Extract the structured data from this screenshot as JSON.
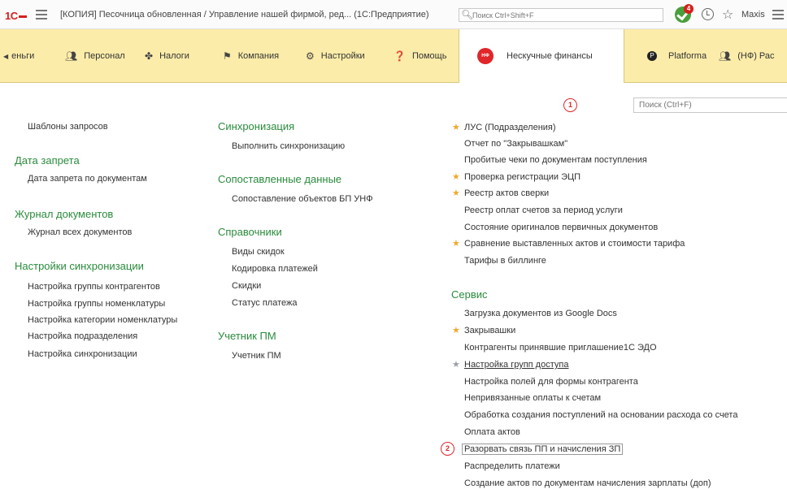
{
  "titlebar": {
    "logo": "1С",
    "title": "[КОПИЯ] Песочница обновленная / Управление нашей фирмой, ред...  (1С:Предприятие)",
    "search_placeholder": "Поиск Ctrl+Shift+F",
    "notification_count": "4",
    "user": "Maxis"
  },
  "sections": [
    {
      "label": "еньги",
      "icon": "money-icon"
    },
    {
      "label": "Персонал",
      "icon": "people-icon"
    },
    {
      "label": "Налоги",
      "icon": "eagle-icon"
    },
    {
      "label": "Компания",
      "icon": "flag-icon"
    },
    {
      "label": "Настройки",
      "icon": "gear-icon"
    },
    {
      "label": "Помощь",
      "icon": "help-icon"
    },
    {
      "label": "Нескучные финансы",
      "icon": "nf-logo-icon",
      "active": true
    },
    {
      "label": "Platforma",
      "icon": "platforma-icon"
    },
    {
      "label": "(НФ) Рас",
      "icon": "people-icon"
    }
  ],
  "nf_icon_text": "НФ",
  "markers": [
    "1",
    "2"
  ],
  "content_search_placeholder": "Поиск (Ctrl+F)",
  "col1": {
    "top_item": "Шаблоны запросов",
    "groups": [
      {
        "title": "Дата запрета",
        "items": [
          "Дата запрета по документам"
        ]
      },
      {
        "title": "Журнал документов",
        "items": [
          "Журнал всех документов"
        ]
      },
      {
        "title": "Настройки синхронизации",
        "items": [
          "Настройка группы контрагентов",
          "Настройка группы номенклатуры",
          "Настройка категории номенклатуры",
          "Настройка подразделения",
          "Настройка синхронизации"
        ]
      }
    ]
  },
  "col2": {
    "groups": [
      {
        "title": "Синхронизация",
        "items": [
          "Выполнить синхронизацию"
        ]
      },
      {
        "title": "Сопоставленные данные",
        "items": [
          "Сопоставление объектов БП УНФ"
        ]
      },
      {
        "title": "Справочники",
        "items": [
          "Виды скидок",
          "Кодировка платежей",
          "Скидки",
          "Статус платежа"
        ]
      },
      {
        "title": "Учетник ПМ",
        "items": [
          "Учетник ПМ"
        ]
      }
    ]
  },
  "col3": {
    "top_items": [
      {
        "label": "ЛУС (Подразделения)",
        "star": "gold"
      },
      {
        "label": "Отчет по \"Закрывашкам\""
      },
      {
        "label": "Пробитые чеки по документам поступления"
      },
      {
        "label": "Проверка регистрации ЭЦП",
        "star": "gold"
      },
      {
        "label": "Реестр актов сверки",
        "star": "gold"
      },
      {
        "label": "Реестр оплат счетов за период услуги"
      },
      {
        "label": "Состояние оригиналов первичных документов"
      },
      {
        "label": "Сравнение выставленных актов и стоимости тарифа",
        "star": "gold"
      },
      {
        "label": "Тарифы в биллинге"
      }
    ],
    "service_title": "Сервис",
    "service_items": [
      {
        "label": "Загрузка документов из Google Docs"
      },
      {
        "label": "Закрывашки",
        "star": "gold"
      },
      {
        "label": "Контрагенты принявшие приглашение1С ЭДО"
      },
      {
        "label": "Настройка групп доступа",
        "star": "gray",
        "underlined": true
      },
      {
        "label": "Настройка полей для формы контрагента"
      },
      {
        "label": "Непривязанные оплаты к счетам"
      },
      {
        "label": "Обработка создания поступлений на основании расхода со счета"
      },
      {
        "label": "Оплата актов"
      },
      {
        "label": "Разорвать связь ПП и начисления ЗП",
        "framed": true
      },
      {
        "label": "Распределить платежи"
      },
      {
        "label": "Создание актов по документам начисления зарплаты (доп)"
      }
    ]
  },
  "colors": {
    "accent_green": "#2a8b3c",
    "sections_bg": "#fbeca9",
    "star_gold": "#f0a830",
    "marker_red": "#e0262a"
  }
}
